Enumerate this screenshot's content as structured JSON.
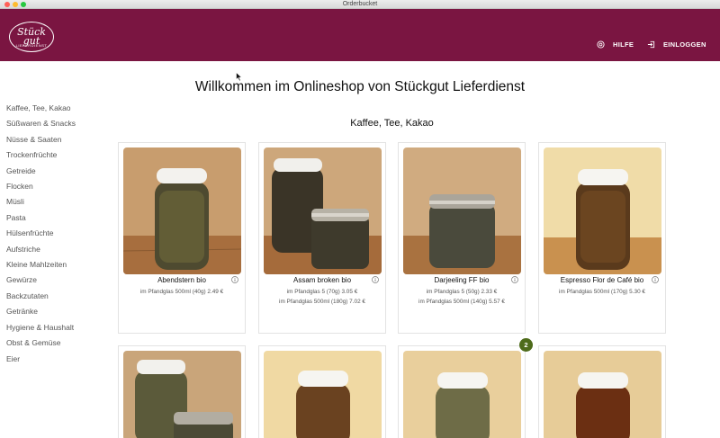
{
  "window": {
    "title": "Orderbucket"
  },
  "header": {
    "logo_text": "Stück gut",
    "logo_sub": "LIEFERDIENST",
    "help_label": "HILFE",
    "login_label": "EINLOGGEN",
    "brand_color": "#7a1541"
  },
  "main": {
    "title": "Willkommen im Onlineshop von Stückgut Lieferdienst",
    "section_title": "Kaffee, Tee, Kakao"
  },
  "sidebar": {
    "items": [
      {
        "label": "Kaffee, Tee, Kakao"
      },
      {
        "label": "Süßwaren & Snacks"
      },
      {
        "label": "Nüsse & Saaten"
      },
      {
        "label": "Trockenfrüchte"
      },
      {
        "label": "Getreide"
      },
      {
        "label": "Flocken"
      },
      {
        "label": "Müsli"
      },
      {
        "label": "Pasta"
      },
      {
        "label": "Hülsenfrüchte"
      },
      {
        "label": "Aufstriche"
      },
      {
        "label": "Kleine Mahlzeiten"
      },
      {
        "label": "Gewürze"
      },
      {
        "label": "Backzutaten"
      },
      {
        "label": "Getränke"
      },
      {
        "label": "Hygiene & Haushalt"
      },
      {
        "label": "Obst & Gemüse"
      },
      {
        "label": "Eier"
      }
    ]
  },
  "products": [
    {
      "name": "Abendstern bio",
      "prices": [
        "im Pfandglas 500ml (40g) 2.49 €"
      ]
    },
    {
      "name": "Assam broken bio",
      "prices": [
        "im Pfandglas 5 (70g) 3.05 €",
        "im Pfandglas 500ml (180g) 7.02 €"
      ]
    },
    {
      "name": "Darjeeling FF bio",
      "prices": [
        "im Pfandglas 5 (50g) 2.33 €",
        "im Pfandglas 500ml (140g) 5.57 €"
      ]
    },
    {
      "name": "Espresso Flor de Café bio",
      "prices": [
        "im Pfandglas 500ml (170g) 5.30 €"
      ]
    },
    {
      "name": "",
      "prices": []
    },
    {
      "name": "",
      "prices": []
    },
    {
      "name": "",
      "prices": []
    },
    {
      "name": "",
      "prices": []
    }
  ],
  "cart_badge": "2"
}
